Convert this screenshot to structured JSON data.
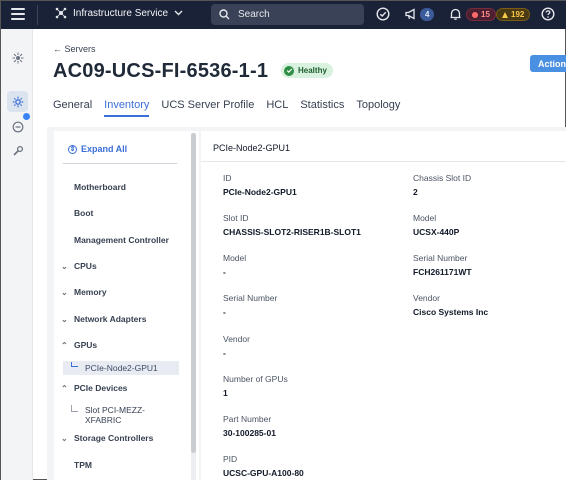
{
  "topbar": {
    "service_name": "Infrastructure Service",
    "search_placeholder": "Search",
    "notifications_count": "4",
    "alarms_critical": "15",
    "alarms_warning": "192"
  },
  "header": {
    "breadcrumb": "Servers",
    "title": "AC09-UCS-FI-6536-1-1",
    "health_status": "Healthy",
    "actions_label": "Actions"
  },
  "tabs": [
    {
      "label": "General"
    },
    {
      "label": "Inventory"
    },
    {
      "label": "UCS Server Profile"
    },
    {
      "label": "HCL"
    },
    {
      "label": "Statistics"
    },
    {
      "label": "Topology"
    }
  ],
  "tree": {
    "expand_all": "Expand All",
    "items": [
      {
        "label": "Motherboard"
      },
      {
        "label": "Boot"
      },
      {
        "label": "Management Controller"
      },
      {
        "label": "CPUs"
      },
      {
        "label": "Memory"
      },
      {
        "label": "Network Adapters"
      },
      {
        "label": "GPUs"
      },
      {
        "label": "PCIe-Node2-GPU1"
      },
      {
        "label": "PCIe Devices"
      },
      {
        "label": "Slot PCI-MEZZ-"
      },
      {
        "label": "XFABRIC"
      },
      {
        "label": "Storage Controllers"
      },
      {
        "label": "TPM"
      }
    ]
  },
  "detail": {
    "title": "PCIe-Node2-GPU1",
    "fields": [
      {
        "label": "ID",
        "value": "PCIe-Node2-GPU1"
      },
      {
        "label": "Chassis Slot ID",
        "value": "2"
      },
      {
        "label": "Slot ID",
        "value": "CHASSIS-SLOT2-RISER1B-SLOT1"
      },
      {
        "label": "Model",
        "value": "UCSX-440P"
      },
      {
        "label": "Model",
        "value": "-"
      },
      {
        "label": "Serial Number",
        "value": "FCH261171WT"
      },
      {
        "label": "Serial Number",
        "value": "-"
      },
      {
        "label": "Vendor",
        "value": "Cisco Systems Inc"
      },
      {
        "label": "Vendor",
        "value": "-"
      },
      {
        "label": "Number of GPUs",
        "value": "1"
      },
      {
        "label": "Part Number",
        "value": "30-100285-01"
      },
      {
        "label": "PID",
        "value": "UCSC-GPU-A100-80"
      }
    ]
  },
  "colors": {
    "topbar_bg": "#1a2238",
    "accent": "#3b6fd8",
    "healthy_bg": "#d9f2df",
    "critical": "#ff8a8a",
    "warning": "#f7c948"
  }
}
